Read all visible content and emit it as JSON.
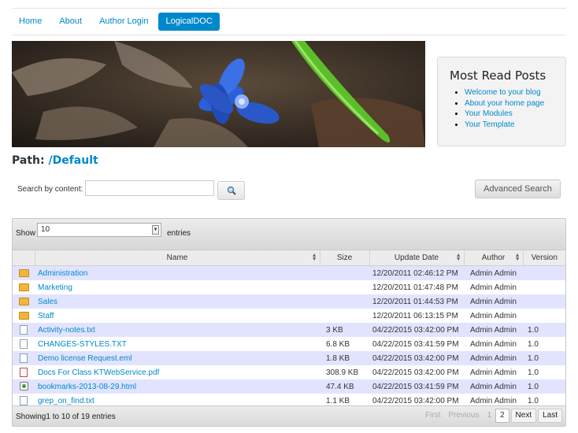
{
  "nav": {
    "items": [
      "Home",
      "About",
      "Author Login",
      "LogicalDOC"
    ],
    "active_index": 3
  },
  "sidebar": {
    "title": "Most Read Posts",
    "links": [
      "Welcome to your blog",
      "About your home page",
      "Your Modules",
      "Your Template"
    ]
  },
  "path": {
    "label": "Path:",
    "value": "/Default"
  },
  "search": {
    "label": "Search by content:",
    "value": "",
    "placeholder": "",
    "button_icon": "search-icon",
    "advanced_label": "Advanced Search"
  },
  "table_controls": {
    "show_label": "Show",
    "page_size": "10",
    "entries_label": "entries"
  },
  "table": {
    "columns": [
      "Name",
      "Size",
      "Update Date",
      "Author",
      "Version"
    ],
    "rows": [
      {
        "icon": "folder-icon",
        "name": "Administration",
        "size": "",
        "date": "12/20/2011 02:46:12 PM",
        "author": "Admin Admin",
        "version": ""
      },
      {
        "icon": "folder-icon",
        "name": "Marketing",
        "size": "",
        "date": "12/20/2011 01:47:48 PM",
        "author": "Admin Admin",
        "version": ""
      },
      {
        "icon": "folder-icon",
        "name": "Sales",
        "size": "",
        "date": "12/20/2011 01:44:53 PM",
        "author": "Admin Admin",
        "version": ""
      },
      {
        "icon": "folder-icon",
        "name": "Staff",
        "size": "",
        "date": "12/20/2011 06:13:15 PM",
        "author": "Admin Admin",
        "version": ""
      },
      {
        "icon": "text-file-icon",
        "name": "Activity-notes.txt",
        "size": "3 KB",
        "date": "04/22/2015 03:42:00 PM",
        "author": "Admin Admin",
        "version": "1.0"
      },
      {
        "icon": "text-file-icon",
        "name": "CHANGES-STYLES.TXT",
        "size": "6.8 KB",
        "date": "04/22/2015 03:41:59 PM",
        "author": "Admin Admin",
        "version": "1.0"
      },
      {
        "icon": "email-file-icon",
        "name": "Demo license Request.eml",
        "size": "1.8 KB",
        "date": "04/22/2015 03:42:00 PM",
        "author": "Admin Admin",
        "version": "1.0"
      },
      {
        "icon": "pdf-file-icon",
        "name": "Docs For Class KTWebService.pdf",
        "size": "308.9 KB",
        "date": "04/22/2015 03:42:00 PM",
        "author": "Admin Admin",
        "version": "1.0"
      },
      {
        "icon": "html-file-icon",
        "name": "bookmarks-2013-08-29.html",
        "size": "47.4 KB",
        "date": "04/22/2015 03:41:59 PM",
        "author": "Admin Admin",
        "version": "1.0"
      },
      {
        "icon": "text-file-icon",
        "name": "grep_on_find.txt",
        "size": "1.1 KB",
        "date": "04/22/2015 03:42:00 PM",
        "author": "Admin Admin",
        "version": "1.0"
      }
    ]
  },
  "footer": {
    "info": "Showing1 to 10 of 19 entries",
    "pager": {
      "first": "First",
      "previous": "Previous",
      "pages": [
        "1",
        "2"
      ],
      "current": "1",
      "next": "Next",
      "last": "Last"
    }
  },
  "colors": {
    "accent": "#0088cc",
    "row_highlight": "#e2e4ff"
  }
}
